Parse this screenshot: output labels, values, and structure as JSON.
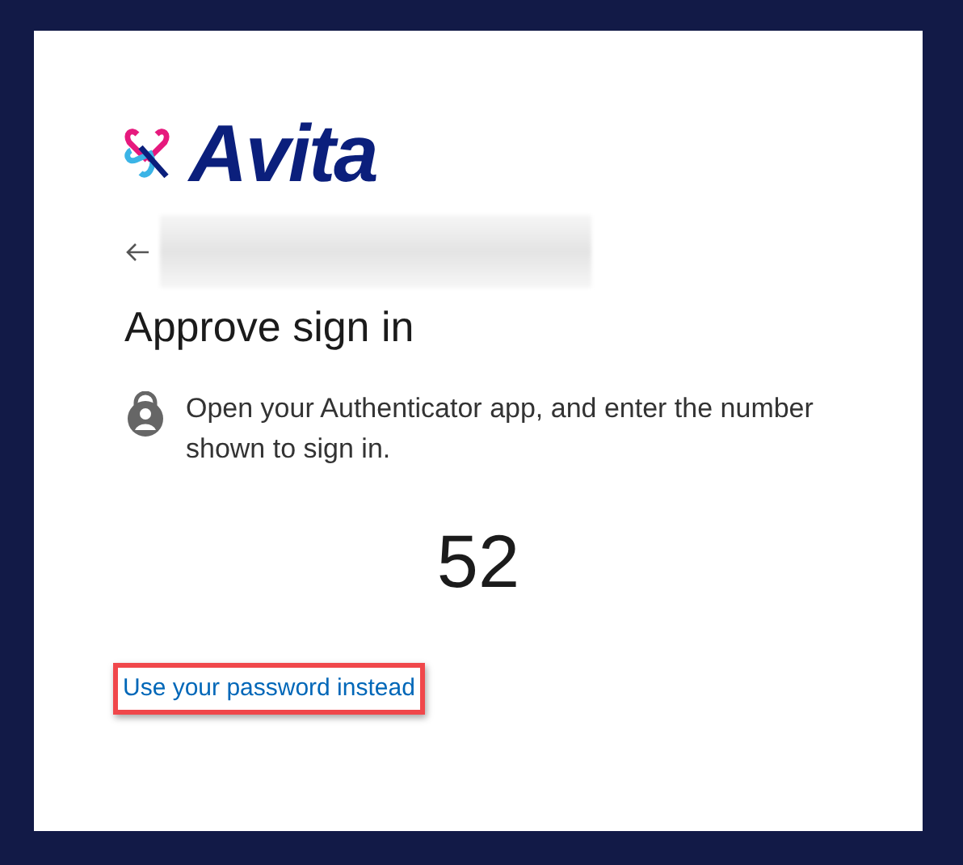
{
  "logo": {
    "text": "Avita"
  },
  "title": "Approve sign in",
  "message": "Open your Authenticator app, and enter the number shown to sign in.",
  "number": "52",
  "link": {
    "text": "Use your password instead",
    "highlighted": true
  }
}
